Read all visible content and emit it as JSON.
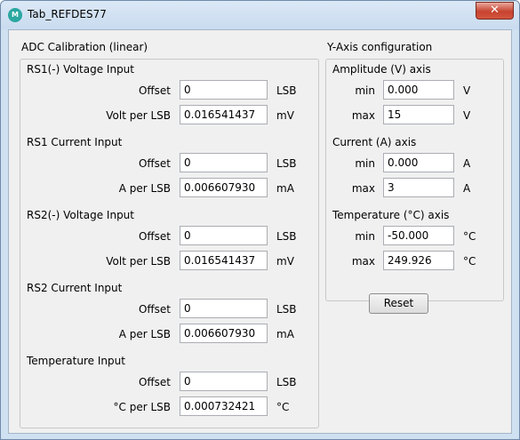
{
  "window": {
    "title": "Tab_REFDES77",
    "icon_name": "maxim-logo-icon",
    "close_glyph": "✕"
  },
  "adc": {
    "title": "ADC Calibration (linear)",
    "rs1v": {
      "title": "RS1(-) Voltage Input",
      "offset_label": "Offset",
      "offset_value": "0",
      "offset_unit": "LSB",
      "scale_label": "Volt per LSB",
      "scale_value": "0.016541437",
      "scale_unit": "mV"
    },
    "rs1i": {
      "title": "RS1 Current Input",
      "offset_label": "Offset",
      "offset_value": "0",
      "offset_unit": "LSB",
      "scale_label": "A per LSB",
      "scale_value": "0.006607930",
      "scale_unit": "mA"
    },
    "rs2v": {
      "title": "RS2(-) Voltage Input",
      "offset_label": "Offset",
      "offset_value": "0",
      "offset_unit": "LSB",
      "scale_label": "Volt per LSB",
      "scale_value": "0.016541437",
      "scale_unit": "mV"
    },
    "rs2i": {
      "title": "RS2 Current Input",
      "offset_label": "Offset",
      "offset_value": "0",
      "offset_unit": "LSB",
      "scale_label": "A per LSB",
      "scale_value": "0.006607930",
      "scale_unit": "mA"
    },
    "temp": {
      "title": "Temperature Input",
      "offset_label": "Offset",
      "offset_value": "0",
      "offset_unit": "LSB",
      "scale_label": "°C per LSB",
      "scale_value": "0.000732421",
      "scale_unit": "°C"
    }
  },
  "yaxis": {
    "title": "Y-Axis configuration",
    "amp": {
      "title": "Amplitude (V) axis",
      "min_label": "min",
      "min_value": "0.000",
      "min_unit": "V",
      "max_label": "max",
      "max_value": "15",
      "max_unit": "V"
    },
    "cur": {
      "title": "Current (A) axis",
      "min_label": "min",
      "min_value": "0.000",
      "min_unit": "A",
      "max_label": "max",
      "max_value": "3",
      "max_unit": "A"
    },
    "temp": {
      "title": "Temperature (°C) axis",
      "min_label": "min",
      "min_value": "-50.000",
      "min_unit": "°C",
      "max_label": "max",
      "max_value": "249.926",
      "max_unit": "°C"
    },
    "reset_label": "Reset"
  }
}
